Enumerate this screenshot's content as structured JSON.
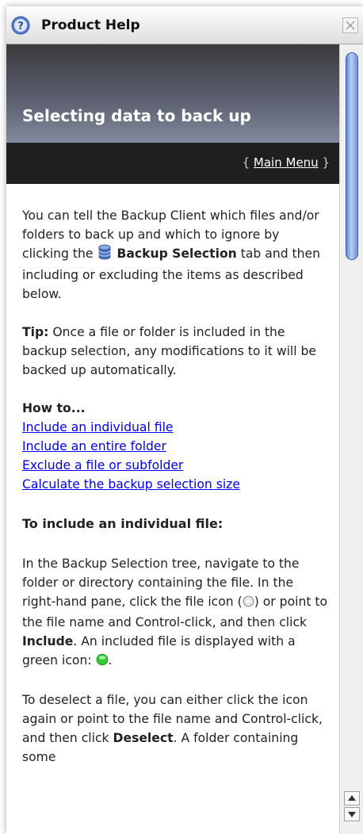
{
  "window": {
    "title": "Product Help",
    "help_icon": "help-icon",
    "close_icon": "close-icon"
  },
  "header": {
    "title": "Selecting data to back up"
  },
  "nav": {
    "open_brace": "{ ",
    "main_menu": "Main Menu",
    "close_brace": " }"
  },
  "intro": {
    "text1": "You can tell the Backup Client which files and/or folders to back up and which to ignore by clicking the",
    "icon": "database-icon",
    "tab_name": "Backup Selection",
    "text2": "tab and then including or excluding the items as described below."
  },
  "tip": {
    "label": "Tip:",
    "text": "Once a file or folder is included in the backup selection, any modifications to it will be backed up automatically."
  },
  "howto": {
    "heading": "How to...",
    "links": [
      "Include an individual file",
      "Include an entire folder",
      "Exclude a file or subfolder",
      "Calculate the backup selection size"
    ]
  },
  "section1": {
    "heading": "To include an individual file:",
    "p1a": "In the Backup Selection tree, navigate to the folder or directory containing the file. In the right-hand pane, click the file icon (",
    "p1b": ") or point to the file name and Control-click, and then click",
    "include": "Include",
    "p1c": ". An included file is displayed with a green icon:",
    "p1d": ".",
    "p2a": "To deselect a file, you can either click the icon again or point to the file name and Control-click, and then click",
    "deselect": "Deselect",
    "p2b": ". A folder containing some"
  },
  "colors": {
    "link": "#0000ee",
    "header_dark": "#3b3b3d",
    "header_light": "#828a9d",
    "navbar": "#1f1f1f",
    "scroll_thumb": "#5f88d6",
    "included_green": "#33cc33"
  }
}
